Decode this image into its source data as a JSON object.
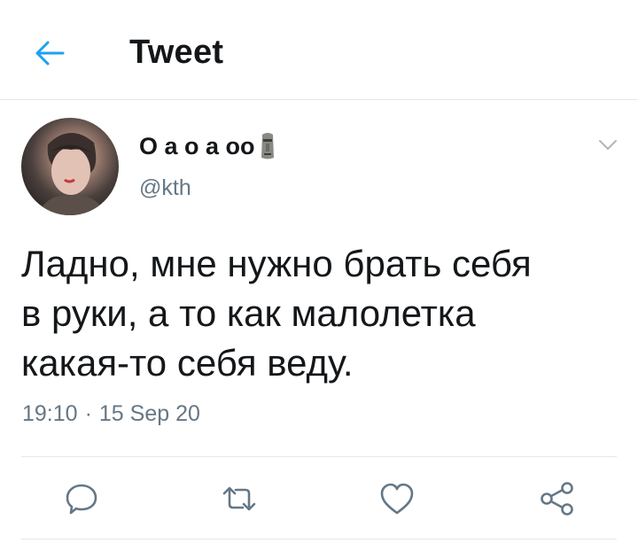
{
  "header": {
    "title": "Tweet",
    "back_icon": "arrow-left-icon"
  },
  "author": {
    "display_name": "О а о а оо",
    "emoji_icon": "moai-icon",
    "handle": "@kth"
  },
  "tweet": {
    "text_lines": [
      "Ладно, мне нужно брать себя",
      "в руки, а то как малолетка",
      "какая-то себя веду."
    ],
    "time": "19:10",
    "separator": "·",
    "date": "15 Sep 20"
  },
  "actions": [
    "reply-icon",
    "retweet-icon",
    "like-icon",
    "share-icon"
  ],
  "colors": {
    "accent": "#1da1f2",
    "text": "#14171a",
    "muted": "#657786",
    "border": "#e1e8ed"
  }
}
